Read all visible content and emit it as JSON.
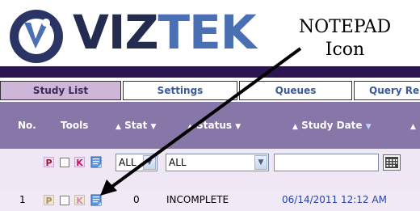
{
  "header": {
    "logo": {
      "name": "VIZTEK",
      "part_dark": "VIZ",
      "part_blue": "TEK"
    },
    "callout": {
      "line1": "NOTEPAD",
      "line2": "Icon"
    }
  },
  "tabs": [
    {
      "label": "Study List",
      "active": true
    },
    {
      "label": "Settings",
      "active": false
    },
    {
      "label": "Queues",
      "active": false
    },
    {
      "label": "Query Re",
      "active": false
    }
  ],
  "grid": {
    "columns": {
      "no": "No.",
      "tools": "Tools",
      "stat": "Stat",
      "status": "Status",
      "study_date": "Study Date"
    },
    "filters": {
      "stat_value": "ALL",
      "status_value": "ALL",
      "date_value": ""
    },
    "tool_icons": [
      "P",
      "K"
    ],
    "rows": [
      {
        "no": "1",
        "stat": "0",
        "status": "INCOMPLETE",
        "study_date": "06/14/2011 12:12 AM"
      }
    ]
  },
  "colors": {
    "purple_bar": "#2b1651",
    "grid_header": "#8776a8",
    "tab_active": "#cdb6d8",
    "link_blue": "#2845a8"
  },
  "icons": {
    "logo_mark": "viztek-logo-icon",
    "notepad": "notepad-icon",
    "calendar": "calendar-icon",
    "dropdown": "chevron-down-icon"
  }
}
